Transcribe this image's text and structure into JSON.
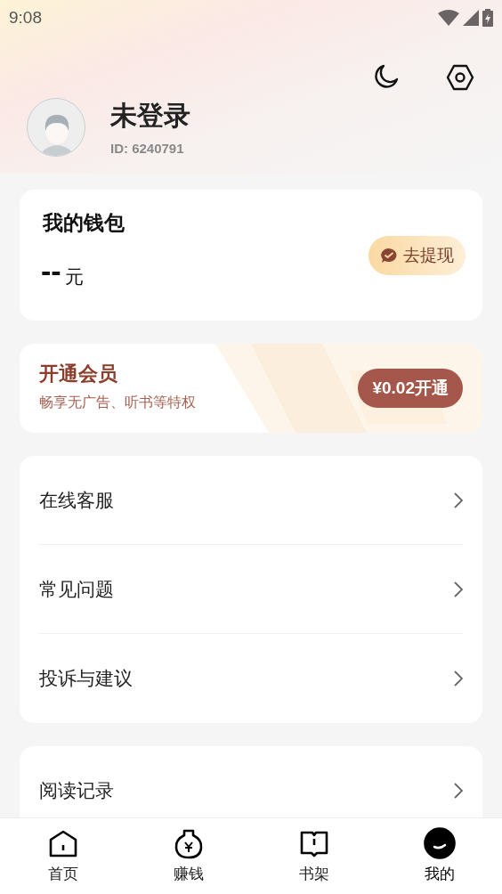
{
  "status_bar": {
    "time": "9:08"
  },
  "profile": {
    "name": "未登录",
    "user_id": "ID: 6240791"
  },
  "wallet": {
    "title": "我的钱包",
    "amount": "--",
    "unit": "元",
    "withdraw_button": "去提现"
  },
  "vip": {
    "title": "开通会员",
    "subtitle": "畅享无广告、听书等特权",
    "button": "¥0.02开通"
  },
  "menu_groups": [
    {
      "items": [
        {
          "label": "在线客服"
        },
        {
          "label": "常见问题"
        },
        {
          "label": "投诉与建议"
        }
      ]
    },
    {
      "items": [
        {
          "label": "阅读记录"
        }
      ]
    }
  ],
  "tabs": [
    {
      "label": "首页",
      "kind": "home",
      "selected": false
    },
    {
      "label": "赚钱",
      "kind": "earn",
      "selected": false
    },
    {
      "label": "书架",
      "kind": "shelf",
      "selected": false
    },
    {
      "label": "我的",
      "kind": "me",
      "selected": true
    }
  ]
}
